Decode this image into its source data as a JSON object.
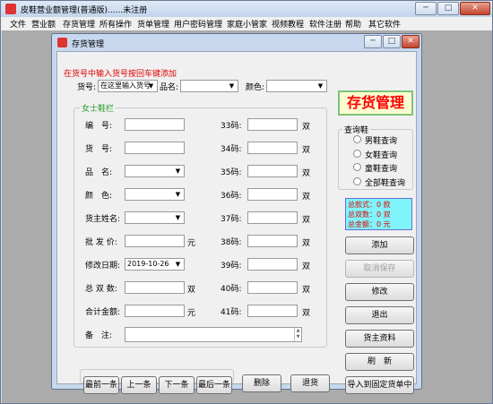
{
  "main_window": {
    "title": "皮鞋营业额管理(普通版)......未注册",
    "caption_min": "─",
    "caption_max": "□",
    "caption_close": "✕"
  },
  "menu": [
    "文件",
    "营业额",
    "存货管理",
    "所有操作",
    "货单管理",
    "用户密码管理",
    "家庭小管家",
    "视频教程",
    "软件注册",
    "帮助",
    "其它软件"
  ],
  "child_window": {
    "title": "存货管理",
    "caption_min": "─",
    "caption_max": "□",
    "caption_close": "✕"
  },
  "hint": "在货号中输入货号按回车键添加",
  "search": {
    "goods_no_label": "货号:",
    "goods_no_value": "在这里输入货号",
    "name_label": "品名:",
    "name_value": "",
    "color_label": "颜色:",
    "color_value": ""
  },
  "banner": "存货管理",
  "women_group": {
    "title": "女士鞋栏",
    "fields": {
      "no_label": "编　号:",
      "goods_label": "货　号:",
      "name_label": "品　名:",
      "color_label": "颜　色:",
      "owner_label": "货主姓名:",
      "price_label": "批 发 价:",
      "price_unit": "元",
      "date_label": "修改日期:",
      "date_value": "2019-10-26",
      "pairs_label": "总 双 数:",
      "pairs_unit": "双",
      "amount_label": "合计金额:",
      "amount_unit": "元",
      "note_label": "备　注:"
    },
    "sizes": [
      {
        "label": "33码:",
        "unit": "双"
      },
      {
        "label": "34码:",
        "unit": "双"
      },
      {
        "label": "35码:",
        "unit": "双"
      },
      {
        "label": "36码:",
        "unit": "双"
      },
      {
        "label": "37码:",
        "unit": "双"
      },
      {
        "label": "38码:",
        "unit": "双"
      },
      {
        "label": "39码:",
        "unit": "双"
      },
      {
        "label": "40码:",
        "unit": "双"
      },
      {
        "label": "41码:",
        "unit": "双"
      }
    ]
  },
  "query_group": {
    "title": "查询鞋",
    "options": [
      "男鞋查询",
      "女鞋查询",
      "童鞋查询",
      "全部鞋查询"
    ]
  },
  "summary": {
    "styles": "总款式：0 款",
    "pairs": "总双数：0 双",
    "amount": "总金额：0 元"
  },
  "nav_buttons": [
    "最前一条",
    "上一条",
    "下一条",
    "最后一条"
  ],
  "action_buttons": {
    "delete": "删除",
    "return": "退货",
    "add": "添加",
    "cancel_save": "取消保存",
    "modify": "修改",
    "exit": "退出",
    "owner_info": "货主资料",
    "refresh": "刷　新",
    "import": "导入到固定货单中"
  }
}
